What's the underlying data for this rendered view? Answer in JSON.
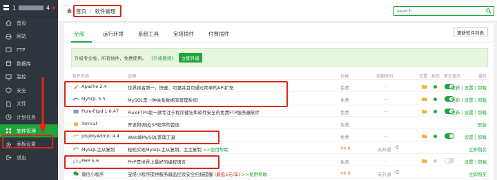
{
  "sidebar": {
    "host_label": "1",
    "host_suffix": "4",
    "items": [
      {
        "label": "首页",
        "icon": "home-icon"
      },
      {
        "label": "网站",
        "icon": "globe-icon"
      },
      {
        "label": "FTP",
        "icon": "ftp-icon"
      },
      {
        "label": "数据库",
        "icon": "database-icon"
      },
      {
        "label": "监控",
        "icon": "monitor-icon"
      },
      {
        "label": "安全",
        "icon": "shield-icon"
      },
      {
        "label": "文件",
        "icon": "file-icon"
      },
      {
        "label": "计划任务",
        "icon": "clock-icon"
      },
      {
        "label": "软件管理",
        "icon": "apps-icon",
        "active": true
      },
      {
        "label": "面板设置",
        "icon": "settings-icon"
      },
      {
        "label": "退出",
        "icon": "logout-icon"
      }
    ]
  },
  "header": {
    "breadcrumb_home": "首页",
    "breadcrumb_sep": "/",
    "breadcrumb_current": "软件管理",
    "search_placeholder": "search"
  },
  "tabs": [
    "全部",
    "运行环境",
    "系统工具",
    "宝塔插件",
    "付费插件"
  ],
  "update_button": "更新软件列表",
  "notice": {
    "text": "升级专业版，所有插件，免费使用。",
    "link": "《升级教程》",
    "button": "立即升级"
  },
  "columns": {
    "name": "软件名称",
    "desc": "说明",
    "price": "价格",
    "expire": "到期时间",
    "location": "位置",
    "status": "状态",
    "home_display": "首页显示",
    "ops": "操作"
  },
  "rows": [
    {
      "name": "Apache 2.4",
      "desc": "世界排名第一，快速、可靠并且可通过简单的API扩充",
      "price": "免费",
      "expire": "--",
      "ops": "更新 | 设置 | 卸载",
      "toggle": "on",
      "icon": "apache-icon"
    },
    {
      "name": "MySQL 5.5",
      "desc": "MySQL是一种关系数据库管理系统!",
      "price": "免费",
      "expire": "--",
      "ops": "更新 | 设置 | 卸载",
      "toggle": "on",
      "icon": "mysql-icon"
    },
    {
      "name": "Pure-Ftpd 1.0.47",
      "desc": "PureFTPd是一款专注于程序健壮和软件安全的免费FTP服务器软件",
      "price": "免费",
      "expire": "--",
      "ops": "更新 | 设置 | 卸载",
      "toggle": "on",
      "icon": "ftp-server-icon"
    },
    {
      "name": "Tomcat",
      "desc": "开发和调试JSP程序的首选",
      "price": "免费",
      "expire": "",
      "ops": "安装",
      "toggle": "",
      "icon": "tomcat-icon"
    },
    {
      "name": "phpMyAdmin 4.4",
      "desc": "Web端MySQL管理工具",
      "price": "免费",
      "expire": "--",
      "ops": "设置 | 卸载",
      "toggle": "on",
      "icon": "phpmyadmin-icon"
    },
    {
      "name": "MySQL主从复制",
      "desc": "轻松实现MySQL主从复制、主主复制",
      "desc_link": ">>使用帮助",
      "price": "¥4.8",
      "expire": "未开通",
      "ops": "立即购买",
      "toggle": "",
      "icon": "replication-icon"
    },
    {
      "name": "PHP-5.6",
      "desc": "PHP是世界上最好的编程语言",
      "price": "免费",
      "expire": "--",
      "ops": "设置 | 卸载",
      "toggle": "off",
      "icon": "php-icon"
    },
    {
      "name": "微信小程序",
      "desc": "宝塔小程序提供服务器监控及安全扫描提醒",
      "desc_extra": "(最低1元/年)",
      "desc_link": ">>使用帮助",
      "price": "¥4.8",
      "expire": "未开通",
      "ops": "立即购买",
      "toggle": "",
      "icon": "wechat-icon"
    }
  ],
  "colors": {
    "accent": "#20a53a",
    "sidebar_bg": "#2f353d",
    "highlight": "#d9261c"
  }
}
